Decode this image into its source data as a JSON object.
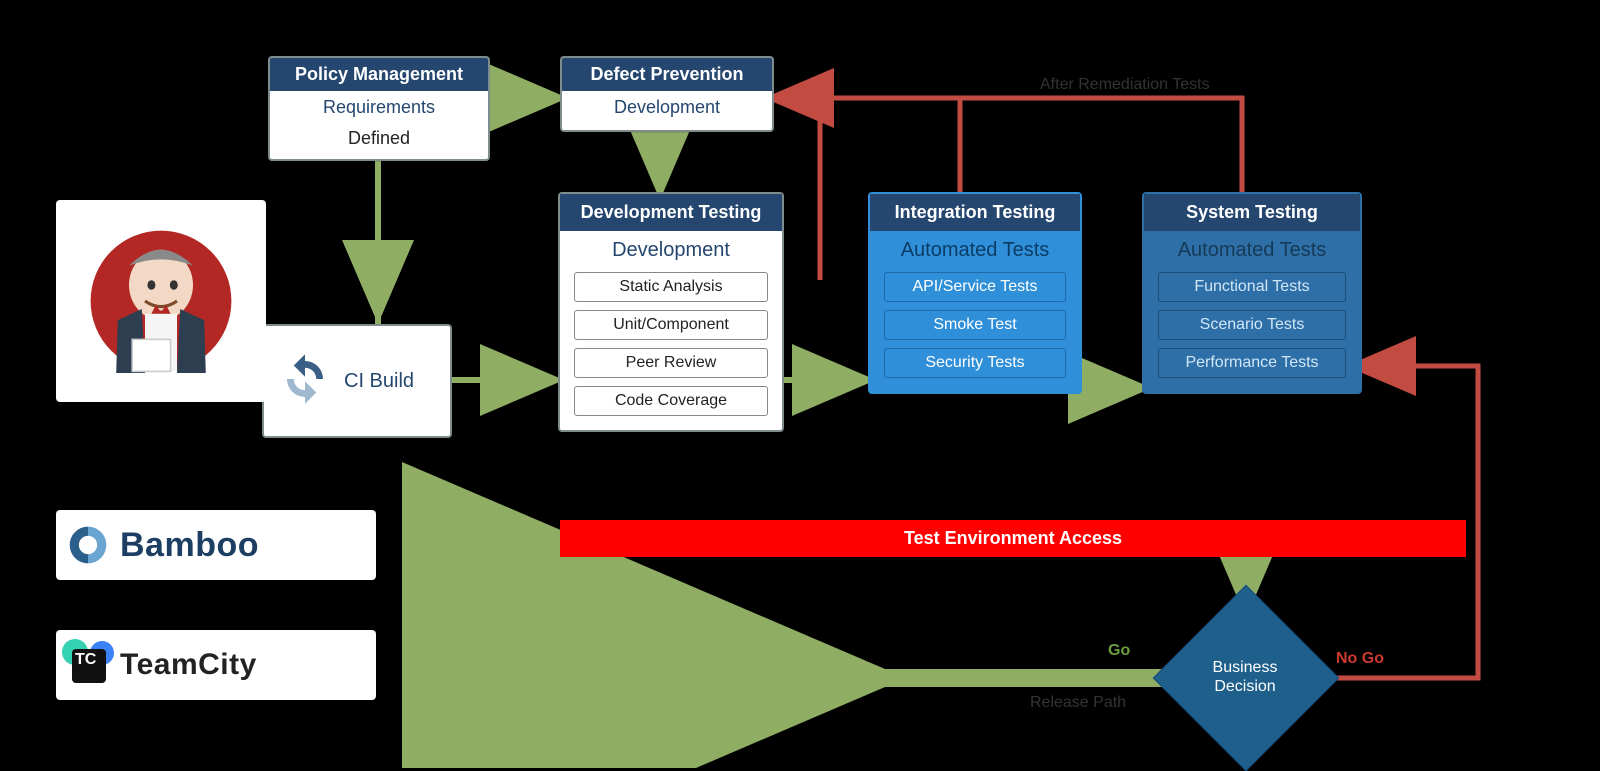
{
  "colors": {
    "header": "#24466f",
    "accentGreen": "#8fae63",
    "accentRed": "#c24b42",
    "envBar": "#ff0000",
    "blue": "#2f8fd8",
    "darkBlue": "#2f6fa8"
  },
  "logos": {
    "jenkins": "Jenkins",
    "bamboo": "Bamboo",
    "teamcity": "TeamCity"
  },
  "nodes": {
    "policy": {
      "title": "Policy Management",
      "subtitle": "Requirements",
      "body": "Defined"
    },
    "defect": {
      "title": "Defect Prevention",
      "body": "Development"
    },
    "ci": {
      "label": "CI Build"
    },
    "devTest": {
      "title": "Development Testing",
      "subtitle": "Development",
      "items": [
        "Static Analysis",
        "Unit/Component",
        "Peer Review",
        "Code Coverage"
      ]
    },
    "intTest": {
      "title": "Integration Testing",
      "subtitle": "Automated Tests",
      "items": [
        "API/Service Tests",
        "Smoke Test",
        "Security Tests"
      ]
    },
    "sysTest": {
      "title": "System Testing",
      "subtitle": "Automated Tests",
      "items": [
        "Functional Tests",
        "Scenario Tests",
        "Performance Tests"
      ]
    },
    "envBar": "Test Environment Access",
    "decision": "Business Decision"
  },
  "edgeLabels": {
    "remediation": "After Remediation Tests",
    "go": "Go",
    "noGo": "No Go",
    "release": "Release Path"
  }
}
